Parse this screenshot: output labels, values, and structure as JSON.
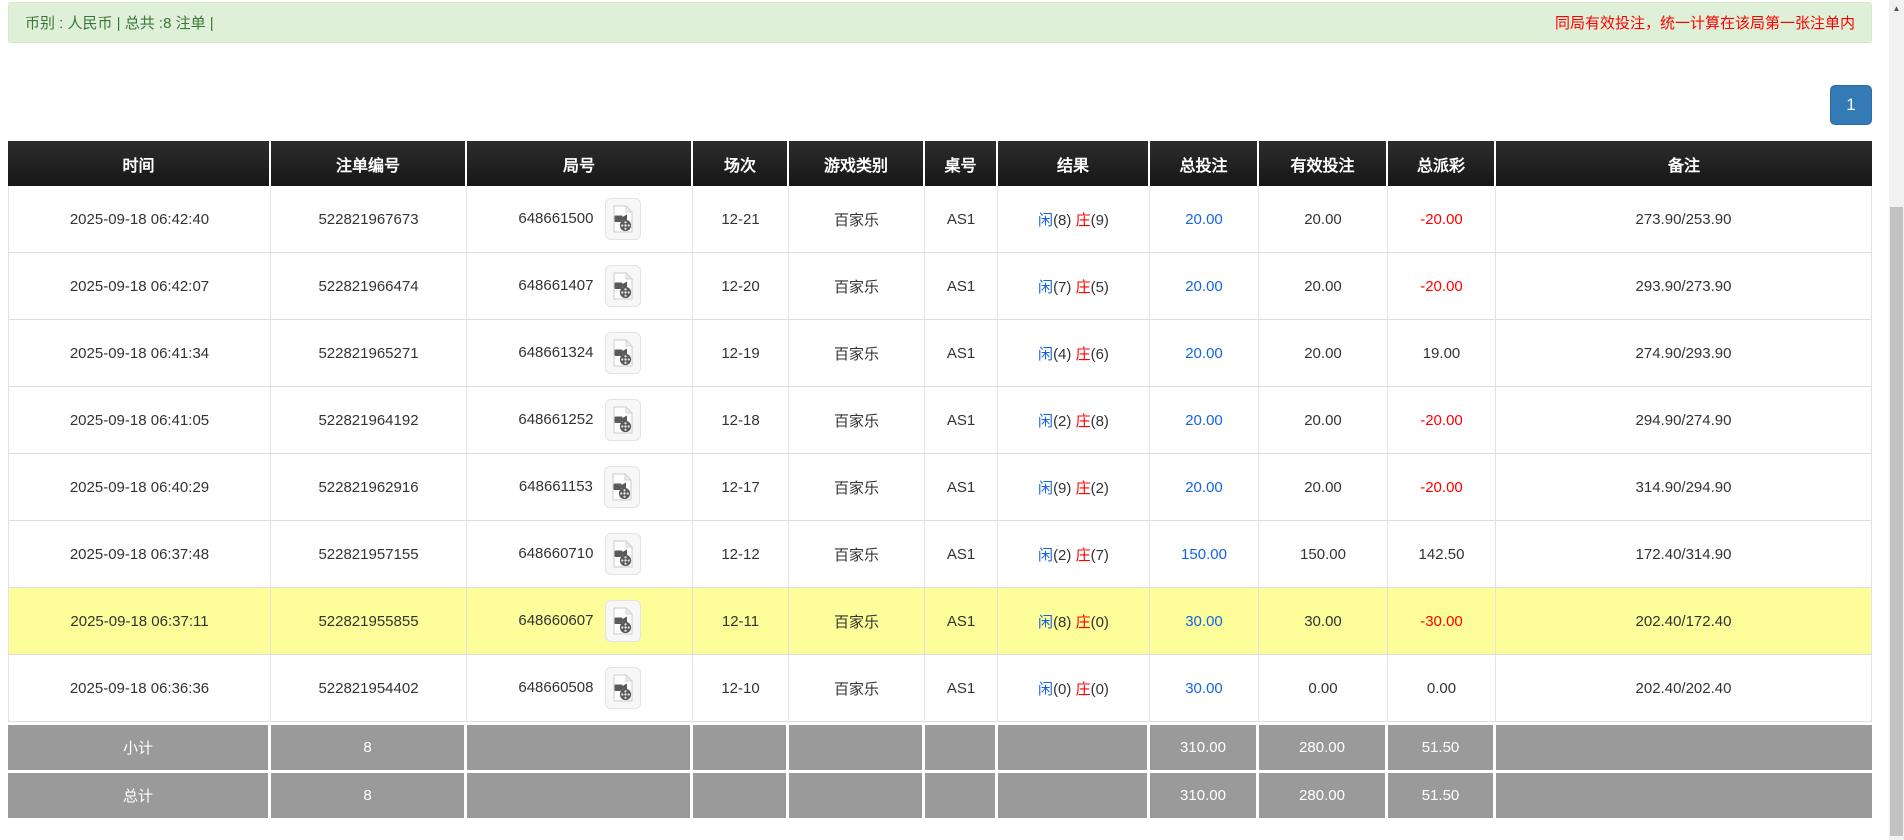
{
  "notice_bar": {
    "left_text": "币别 : 人民币 | 总共 :8 注单 |",
    "right_text": "同局有效投注，统一计算在该局第一张注单内"
  },
  "pagination": {
    "page_label": "1"
  },
  "table": {
    "headers": [
      "时间",
      "注单编号",
      "局号",
      "场次",
      "游戏类别",
      "桌号",
      "结果",
      "总投注",
      "有效投注",
      "总派彩",
      "备注"
    ],
    "rows": [
      {
        "time": "2025-09-18 06:42:40",
        "bet_no": "522821967673",
        "round_no": "648661500",
        "session": "12-21",
        "game": "百家乐",
        "table_no": "AS1",
        "result": {
          "player_label": "闲",
          "player_score": "(8)",
          "banker_label": "庄",
          "banker_score": "(9)"
        },
        "total_bet": "20.00",
        "valid_bet": "20.00",
        "payout": "-20.00",
        "remark": "273.90/253.90",
        "highlighted": false
      },
      {
        "time": "2025-09-18 06:42:07",
        "bet_no": "522821966474",
        "round_no": "648661407",
        "session": "12-20",
        "game": "百家乐",
        "table_no": "AS1",
        "result": {
          "player_label": "闲",
          "player_score": "(7)",
          "banker_label": "庄",
          "banker_score": "(5)"
        },
        "total_bet": "20.00",
        "valid_bet": "20.00",
        "payout": "-20.00",
        "remark": "293.90/273.90",
        "highlighted": false
      },
      {
        "time": "2025-09-18 06:41:34",
        "bet_no": "522821965271",
        "round_no": "648661324",
        "session": "12-19",
        "game": "百家乐",
        "table_no": "AS1",
        "result": {
          "player_label": "闲",
          "player_score": "(4)",
          "banker_label": "庄",
          "banker_score": "(6)"
        },
        "total_bet": "20.00",
        "valid_bet": "20.00",
        "payout": "19.00",
        "remark": "274.90/293.90",
        "highlighted": false
      },
      {
        "time": "2025-09-18 06:41:05",
        "bet_no": "522821964192",
        "round_no": "648661252",
        "session": "12-18",
        "game": "百家乐",
        "table_no": "AS1",
        "result": {
          "player_label": "闲",
          "player_score": "(2)",
          "banker_label": "庄",
          "banker_score": "(8)"
        },
        "total_bet": "20.00",
        "valid_bet": "20.00",
        "payout": "-20.00",
        "remark": "294.90/274.90",
        "highlighted": false
      },
      {
        "time": "2025-09-18 06:40:29",
        "bet_no": "522821962916",
        "round_no": "648661153",
        "session": "12-17",
        "game": "百家乐",
        "table_no": "AS1",
        "result": {
          "player_label": "闲",
          "player_score": "(9)",
          "banker_label": "庄",
          "banker_score": "(2)"
        },
        "total_bet": "20.00",
        "valid_bet": "20.00",
        "payout": "-20.00",
        "remark": "314.90/294.90",
        "highlighted": false
      },
      {
        "time": "2025-09-18 06:37:48",
        "bet_no": "522821957155",
        "round_no": "648660710",
        "session": "12-12",
        "game": "百家乐",
        "table_no": "AS1",
        "result": {
          "player_label": "闲",
          "player_score": "(2)",
          "banker_label": "庄",
          "banker_score": "(7)"
        },
        "total_bet": "150.00",
        "valid_bet": "150.00",
        "payout": "142.50",
        "remark": "172.40/314.90",
        "highlighted": false
      },
      {
        "time": "2025-09-18 06:37:11",
        "bet_no": "522821955855",
        "round_no": "648660607",
        "session": "12-11",
        "game": "百家乐",
        "table_no": "AS1",
        "result": {
          "player_label": "闲",
          "player_score": "(8)",
          "banker_label": "庄",
          "banker_score": "(0)"
        },
        "total_bet": "30.00",
        "valid_bet": "30.00",
        "payout": "-30.00",
        "remark": "202.40/172.40",
        "highlighted": true
      },
      {
        "time": "2025-09-18 06:36:36",
        "bet_no": "522821954402",
        "round_no": "648660508",
        "session": "12-10",
        "game": "百家乐",
        "table_no": "AS1",
        "result": {
          "player_label": "闲",
          "player_score": "(0)",
          "banker_label": "庄",
          "banker_score": "(0)"
        },
        "total_bet": "30.00",
        "valid_bet": "0.00",
        "payout": "0.00",
        "remark": "202.40/202.40",
        "highlighted": false
      }
    ],
    "footer_rows": [
      {
        "label": "小计",
        "count": "8",
        "total_bet": "310.00",
        "valid_bet": "280.00",
        "payout": "51.50"
      },
      {
        "label": "总计",
        "count": "8",
        "total_bet": "310.00",
        "valid_bet": "280.00",
        "payout": "51.50"
      }
    ]
  },
  "icons": {
    "video_replay": "video-replay-icon",
    "scroll_up_glyph": "▲"
  },
  "colors": {
    "notice_bg": "#dff0d8",
    "notice_text": "#3c763d",
    "alert_red": "#ff0000",
    "link_blue": "#1565e0",
    "player_blue": "#1565e0",
    "banker_red": "#ff0000",
    "highlight_yellow": "#fdfd99",
    "header_bg": "#161616",
    "footer_bg": "#9a9a9a",
    "pager_blue": "#337ab7"
  }
}
